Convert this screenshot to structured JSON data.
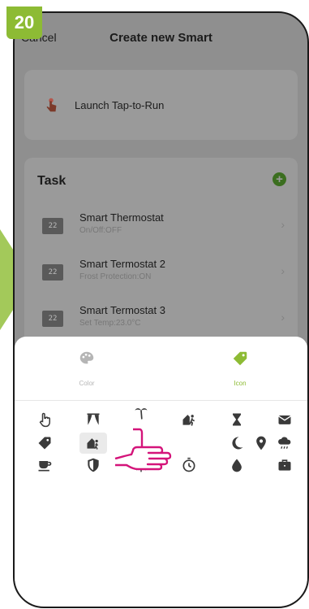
{
  "step_number": "20",
  "header": {
    "cancel_label": "Cancel",
    "title": "Create new Smart"
  },
  "tap_to_run": {
    "label": "Launch Tap-to-Run",
    "icon": "tap-hand-icon"
  },
  "task": {
    "title": "Task",
    "add_icon": "plus-circle-icon",
    "items": [
      {
        "display": "22",
        "name": "Smart Thermostat",
        "status": "On/Off:OFF"
      },
      {
        "display": "22",
        "name": "Smart Termostat 2",
        "status": "Frost Protection:ON"
      },
      {
        "display": "22",
        "name": "Smart Termostat 3",
        "status": "Set Temp:23.0°C"
      }
    ]
  },
  "picker": {
    "tabs": [
      {
        "label": "Color",
        "icon": "palette-icon",
        "active": false
      },
      {
        "label": "Icon",
        "icon": "tag-icon",
        "active": true
      }
    ],
    "icons": [
      "hand-pointer-icon",
      "curtains-icon",
      "palm-tree-icon",
      "person-walking-icon",
      "hourglass-icon",
      "envelope-icon",
      "tag-icon",
      "home-person-icon",
      "",
      "",
      "moon-icon",
      "location-pin-icon",
      "rain-cloud-icon",
      "coffee-cup-icon",
      "shield-icon",
      "sun-icon",
      "timer-icon",
      "water-drop-icon",
      "briefcase-icon"
    ],
    "selected_icon": "home-person-icon"
  },
  "colors": {
    "accent": "#8dbb34",
    "dim_overlay": "#8f8f8f",
    "icon": "#3a3a3a"
  }
}
